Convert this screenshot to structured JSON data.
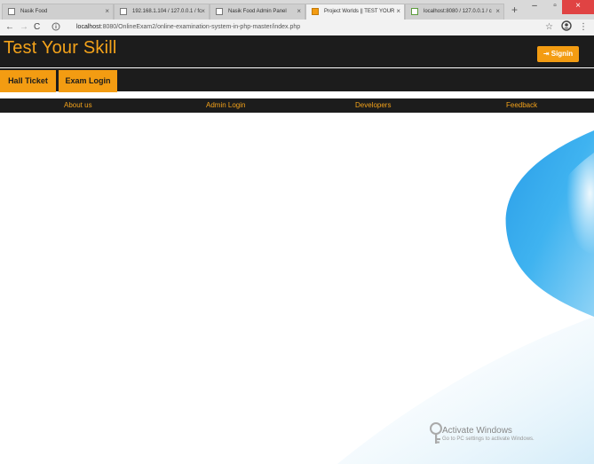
{
  "browser": {
    "tabs": [
      {
        "title": "Nasik Food"
      },
      {
        "title": "192.168.1.104 / 127.0.0.1 / fc"
      },
      {
        "title": "Nasik Food Admin Panel"
      },
      {
        "title": "Project Worlds || TEST YOUR"
      },
      {
        "title": "localhost:8080 / 127.0.0.1 / c"
      }
    ],
    "url_host": "localhost",
    "url_rest": ":8080/OnlineExam2/online-examination-system-in-php-master/index.php"
  },
  "site": {
    "brand": "Test Your Skill",
    "signin_label": "Signin",
    "hall_ticket_label": "Hall Ticket",
    "exam_login_label": "Exam Login",
    "menu": [
      "About us",
      "Admin Login",
      "Developers",
      "Feedback"
    ]
  },
  "windows_watermark": {
    "title": "Activate Windows",
    "subtitle": "Go to PC settings to activate Windows."
  }
}
